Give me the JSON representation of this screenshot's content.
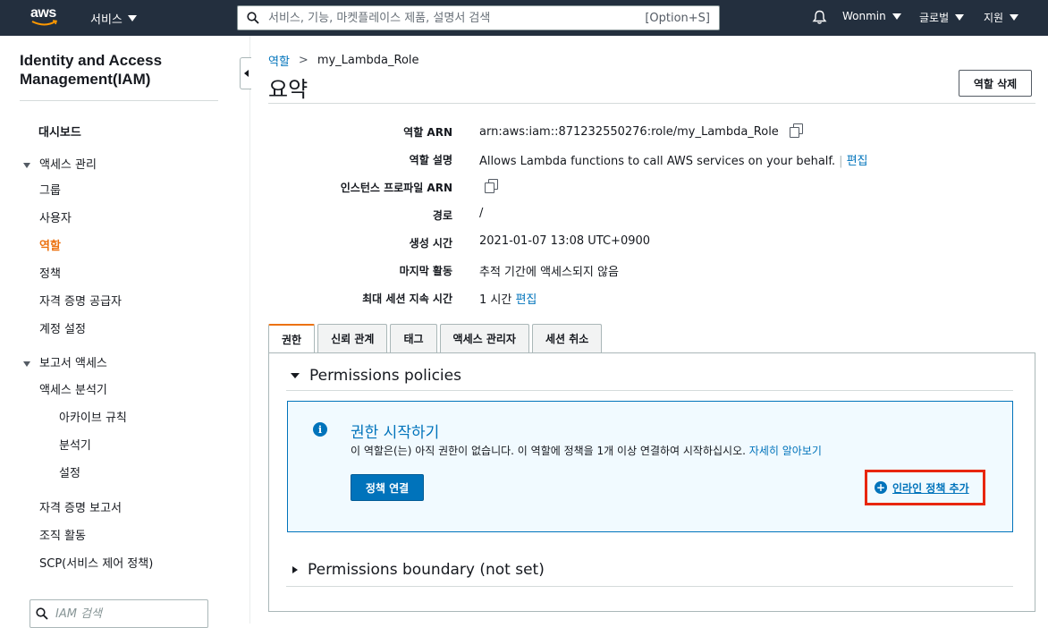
{
  "topnav": {
    "logo": "aws",
    "services_label": "서비스",
    "search_placeholder": "서비스, 기능, 마켓플레이스 제품, 설명서 검색",
    "search_shortcut": "[Option+S]",
    "user_label": "Wonmin",
    "region_label": "글로벌",
    "support_label": "지원",
    "icons": [
      "bell-icon",
      "search-icon"
    ]
  },
  "sidebar": {
    "title": "Identity and Access Management(IAM)",
    "items": [
      {
        "label": "대시보드"
      },
      {
        "label": "액세스 관리"
      },
      {
        "label": "그룹"
      },
      {
        "label": "사용자"
      },
      {
        "label": "역할"
      },
      {
        "label": "정책"
      },
      {
        "label": "자격 증명 공급자"
      },
      {
        "label": "계정 설정"
      },
      {
        "label": "보고서 액세스"
      },
      {
        "label": "액세스 분석기"
      },
      {
        "label": "아카이브 규칙"
      },
      {
        "label": "분석기"
      },
      {
        "label": "설정"
      },
      {
        "label": "자격 증명 보고서"
      },
      {
        "label": "조직 활동"
      },
      {
        "label": "SCP(서비스 제어 정책)"
      }
    ],
    "search_placeholder": "IAM 검색",
    "active_color": "#ec7211"
  },
  "breadcrumb": {
    "parent": "역할",
    "separator": ">",
    "current": "my_Lambda_Role"
  },
  "page": {
    "title": "요약",
    "delete_button": "역할 삭제"
  },
  "summary": [
    {
      "label": "역할 ARN",
      "value": "arn:aws:iam::871232550276:role/my_Lambda_Role"
    },
    {
      "label": "역할 설명",
      "value": "Allows Lambda functions to call AWS services on your behalf.",
      "separator": "|",
      "link": "편집"
    },
    {
      "label": "인스턴스 프로파일 ARN",
      "value": ""
    },
    {
      "label": "경로",
      "value": "/"
    },
    {
      "label": "생성 시간",
      "value": "2021-01-07 13:08 UTC+0900"
    },
    {
      "label": "마지막 활동",
      "value": "추적 기간에 액세스되지 않음"
    },
    {
      "label": "최대 세션 지속 시간",
      "value": "1 시간",
      "link": "편집"
    }
  ],
  "tabs": [
    "권한",
    "신뢰 관계",
    "태그",
    "액세스 관리자",
    "세션 취소"
  ],
  "permissions": {
    "policies_heading": "Permissions policies",
    "info_title": "권한 시작하기",
    "info_text": "이 역할은(는) 아직 권한이 없습니다. 이 역할에 정책을 1개 이상 연결하여 시작하십시오.",
    "info_link": "자세히 알아보기",
    "attach_button": "정책 연결",
    "inline_policy_label": "인라인 정책 추가",
    "boundary_heading": "Permissions boundary (not set)"
  },
  "colors": {
    "nav_bg": "#232f3e",
    "link": "#0073bb",
    "accent": "#ec7211",
    "highlight": "#e8260c"
  }
}
